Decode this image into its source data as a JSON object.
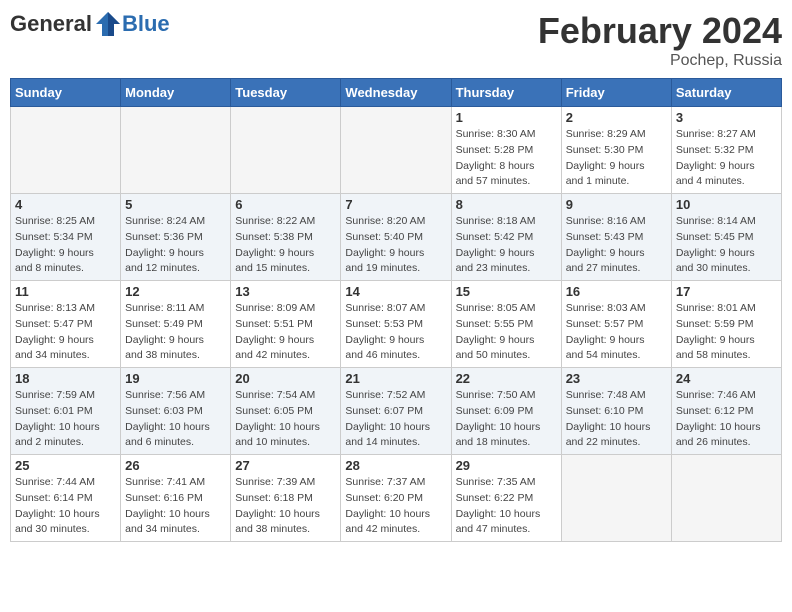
{
  "header": {
    "logo_general": "General",
    "logo_blue": "Blue",
    "month": "February 2024",
    "location": "Pochep, Russia"
  },
  "days_of_week": [
    "Sunday",
    "Monday",
    "Tuesday",
    "Wednesday",
    "Thursday",
    "Friday",
    "Saturday"
  ],
  "weeks": [
    [
      {
        "num": "",
        "info": ""
      },
      {
        "num": "",
        "info": ""
      },
      {
        "num": "",
        "info": ""
      },
      {
        "num": "",
        "info": ""
      },
      {
        "num": "1",
        "info": "Sunrise: 8:30 AM\nSunset: 5:28 PM\nDaylight: 8 hours\nand 57 minutes."
      },
      {
        "num": "2",
        "info": "Sunrise: 8:29 AM\nSunset: 5:30 PM\nDaylight: 9 hours\nand 1 minute."
      },
      {
        "num": "3",
        "info": "Sunrise: 8:27 AM\nSunset: 5:32 PM\nDaylight: 9 hours\nand 4 minutes."
      }
    ],
    [
      {
        "num": "4",
        "info": "Sunrise: 8:25 AM\nSunset: 5:34 PM\nDaylight: 9 hours\nand 8 minutes."
      },
      {
        "num": "5",
        "info": "Sunrise: 8:24 AM\nSunset: 5:36 PM\nDaylight: 9 hours\nand 12 minutes."
      },
      {
        "num": "6",
        "info": "Sunrise: 8:22 AM\nSunset: 5:38 PM\nDaylight: 9 hours\nand 15 minutes."
      },
      {
        "num": "7",
        "info": "Sunrise: 8:20 AM\nSunset: 5:40 PM\nDaylight: 9 hours\nand 19 minutes."
      },
      {
        "num": "8",
        "info": "Sunrise: 8:18 AM\nSunset: 5:42 PM\nDaylight: 9 hours\nand 23 minutes."
      },
      {
        "num": "9",
        "info": "Sunrise: 8:16 AM\nSunset: 5:43 PM\nDaylight: 9 hours\nand 27 minutes."
      },
      {
        "num": "10",
        "info": "Sunrise: 8:14 AM\nSunset: 5:45 PM\nDaylight: 9 hours\nand 30 minutes."
      }
    ],
    [
      {
        "num": "11",
        "info": "Sunrise: 8:13 AM\nSunset: 5:47 PM\nDaylight: 9 hours\nand 34 minutes."
      },
      {
        "num": "12",
        "info": "Sunrise: 8:11 AM\nSunset: 5:49 PM\nDaylight: 9 hours\nand 38 minutes."
      },
      {
        "num": "13",
        "info": "Sunrise: 8:09 AM\nSunset: 5:51 PM\nDaylight: 9 hours\nand 42 minutes."
      },
      {
        "num": "14",
        "info": "Sunrise: 8:07 AM\nSunset: 5:53 PM\nDaylight: 9 hours\nand 46 minutes."
      },
      {
        "num": "15",
        "info": "Sunrise: 8:05 AM\nSunset: 5:55 PM\nDaylight: 9 hours\nand 50 minutes."
      },
      {
        "num": "16",
        "info": "Sunrise: 8:03 AM\nSunset: 5:57 PM\nDaylight: 9 hours\nand 54 minutes."
      },
      {
        "num": "17",
        "info": "Sunrise: 8:01 AM\nSunset: 5:59 PM\nDaylight: 9 hours\nand 58 minutes."
      }
    ],
    [
      {
        "num": "18",
        "info": "Sunrise: 7:59 AM\nSunset: 6:01 PM\nDaylight: 10 hours\nand 2 minutes."
      },
      {
        "num": "19",
        "info": "Sunrise: 7:56 AM\nSunset: 6:03 PM\nDaylight: 10 hours\nand 6 minutes."
      },
      {
        "num": "20",
        "info": "Sunrise: 7:54 AM\nSunset: 6:05 PM\nDaylight: 10 hours\nand 10 minutes."
      },
      {
        "num": "21",
        "info": "Sunrise: 7:52 AM\nSunset: 6:07 PM\nDaylight: 10 hours\nand 14 minutes."
      },
      {
        "num": "22",
        "info": "Sunrise: 7:50 AM\nSunset: 6:09 PM\nDaylight: 10 hours\nand 18 minutes."
      },
      {
        "num": "23",
        "info": "Sunrise: 7:48 AM\nSunset: 6:10 PM\nDaylight: 10 hours\nand 22 minutes."
      },
      {
        "num": "24",
        "info": "Sunrise: 7:46 AM\nSunset: 6:12 PM\nDaylight: 10 hours\nand 26 minutes."
      }
    ],
    [
      {
        "num": "25",
        "info": "Sunrise: 7:44 AM\nSunset: 6:14 PM\nDaylight: 10 hours\nand 30 minutes."
      },
      {
        "num": "26",
        "info": "Sunrise: 7:41 AM\nSunset: 6:16 PM\nDaylight: 10 hours\nand 34 minutes."
      },
      {
        "num": "27",
        "info": "Sunrise: 7:39 AM\nSunset: 6:18 PM\nDaylight: 10 hours\nand 38 minutes."
      },
      {
        "num": "28",
        "info": "Sunrise: 7:37 AM\nSunset: 6:20 PM\nDaylight: 10 hours\nand 42 minutes."
      },
      {
        "num": "29",
        "info": "Sunrise: 7:35 AM\nSunset: 6:22 PM\nDaylight: 10 hours\nand 47 minutes."
      },
      {
        "num": "",
        "info": ""
      },
      {
        "num": "",
        "info": ""
      }
    ]
  ]
}
